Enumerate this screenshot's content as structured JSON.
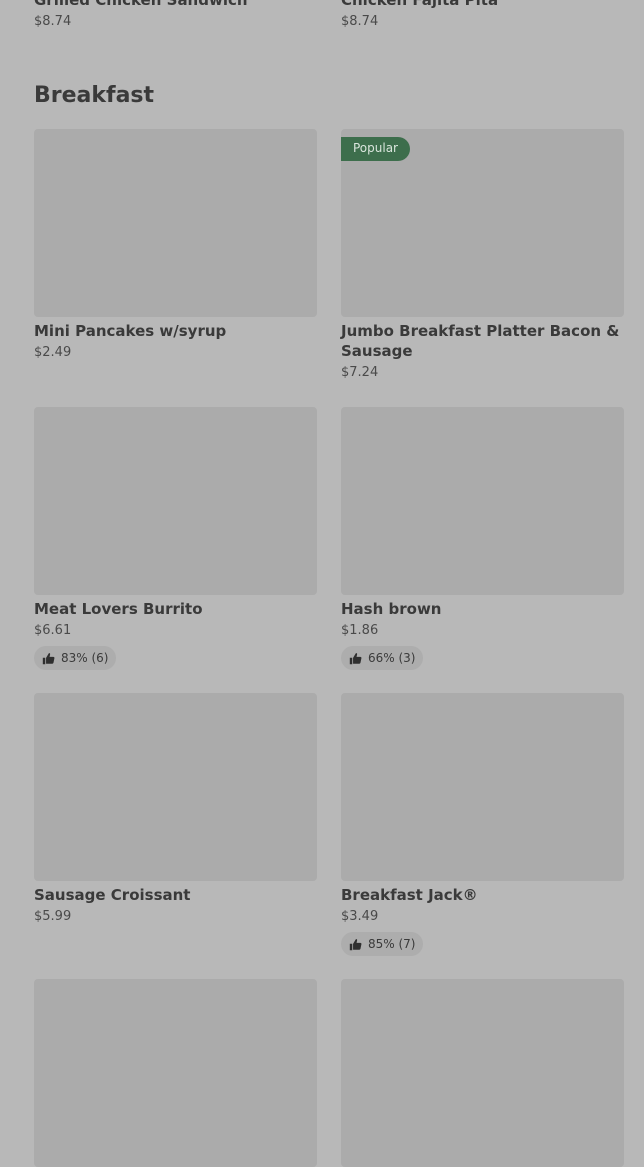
{
  "previous_section": {
    "items": [
      {
        "name": "Grilled Chicken Sandwich",
        "price": "$8.74"
      },
      {
        "name": "Chicken Fajita Pita",
        "price": "$8.74"
      }
    ]
  },
  "section": {
    "title": "Breakfast",
    "items": [
      {
        "name": "Mini Pancakes w/syrup",
        "price": "$2.49",
        "badge": null,
        "rating": null
      },
      {
        "name": "Jumbo Breakfast Platter Bacon & Sausage",
        "price": "$7.24",
        "badge": "Popular",
        "rating": null
      },
      {
        "name": "Meat Lovers Burrito",
        "price": "$6.61",
        "badge": null,
        "rating": "83% (6)"
      },
      {
        "name": "Hash brown",
        "price": "$1.86",
        "badge": null,
        "rating": "66% (3)"
      },
      {
        "name": "Sausage Croissant",
        "price": "$5.99",
        "badge": null,
        "rating": null
      },
      {
        "name": "Breakfast Jack®",
        "price": "$3.49",
        "badge": null,
        "rating": "85% (7)"
      }
    ]
  },
  "icons": {
    "rating": "thumbs-up-icon"
  },
  "colors": {
    "badge_bg": "#3d6e4c",
    "background": "#b8b8b8",
    "placeholder": "#ababab"
  }
}
